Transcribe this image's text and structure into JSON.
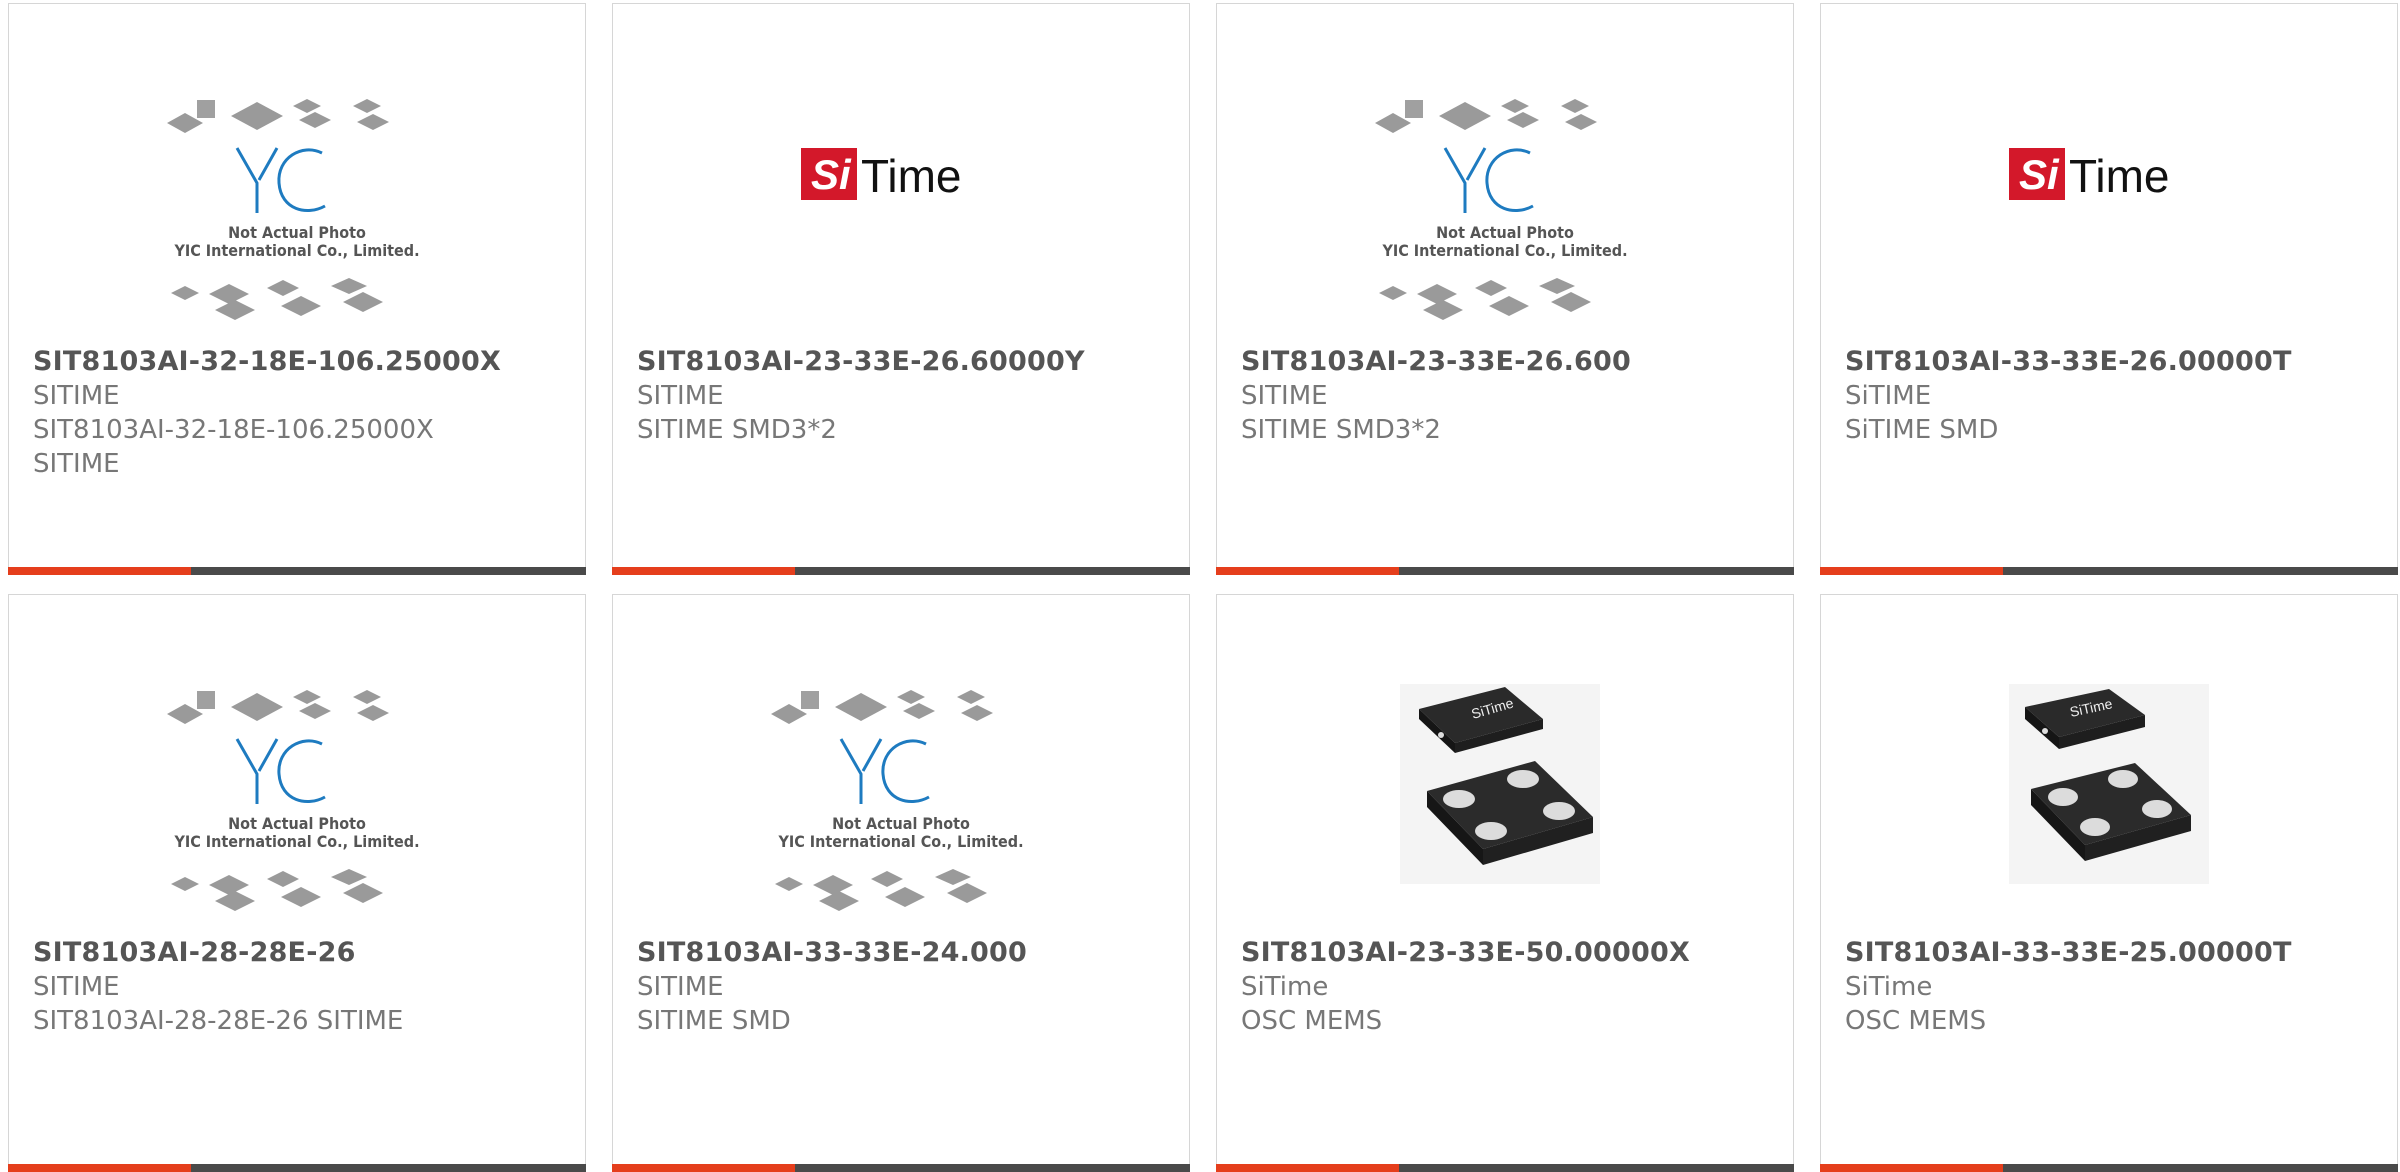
{
  "accent_color": "#e53e1c",
  "bar_color": "#4a4a4a",
  "products": [
    {
      "part_number": "SIT8103AI-32-18E-106.25000X",
      "manufacturer": "SITIME",
      "description": "SIT8103AI-32-18E-106.25000X",
      "description2": "SITIME",
      "image": "yic-placeholder-icon",
      "image_caption_1": "Not Actual Photo",
      "image_caption_2": "YIC International Co., Limited."
    },
    {
      "part_number": "SIT8103AI-23-33E-26.60000Y",
      "manufacturer": "SITIME",
      "description": "SITIME SMD3*2",
      "description2": "",
      "image": "sitime-logo-icon",
      "logo_text_1": "Si",
      "logo_text_2": "Time"
    },
    {
      "part_number": "SIT8103AI-23-33E-26.600",
      "manufacturer": "SITIME",
      "description": "SITIME SMD3*2",
      "description2": "",
      "image": "yic-placeholder-icon",
      "image_caption_1": "Not Actual Photo",
      "image_caption_2": "YIC International Co., Limited."
    },
    {
      "part_number": "SIT8103AI-33-33E-26.00000T",
      "manufacturer": "SiTIME",
      "description": "SiTIME SMD",
      "description2": "",
      "image": "sitime-logo-icon",
      "logo_text_1": "Si",
      "logo_text_2": "Time"
    },
    {
      "part_number": "SIT8103AI-28-28E-26",
      "manufacturer": "SITIME",
      "description": "SIT8103AI-28-28E-26 SITIME",
      "description2": "",
      "image": "yic-placeholder-icon",
      "image_caption_1": "Not Actual Photo",
      "image_caption_2": "YIC International Co., Limited."
    },
    {
      "part_number": "SIT8103AI-33-33E-24.000",
      "manufacturer": "SITIME",
      "description": "SITIME SMD",
      "description2": "",
      "image": "yic-placeholder-icon",
      "image_caption_1": "Not Actual Photo",
      "image_caption_2": "YIC International Co., Limited."
    },
    {
      "part_number": "SIT8103AI-23-33E-50.00000X",
      "manufacturer": "SiTime",
      "description": "OSC MEMS",
      "description2": "",
      "image": "mems-oscillator-chip-icon",
      "chip_label": "SiTime"
    },
    {
      "part_number": "SIT8103AI-33-33E-25.00000T",
      "manufacturer": "SiTime",
      "description": "OSC MEMS",
      "description2": "",
      "image": "mems-oscillator-chip-icon",
      "chip_label": "SiTime"
    }
  ]
}
